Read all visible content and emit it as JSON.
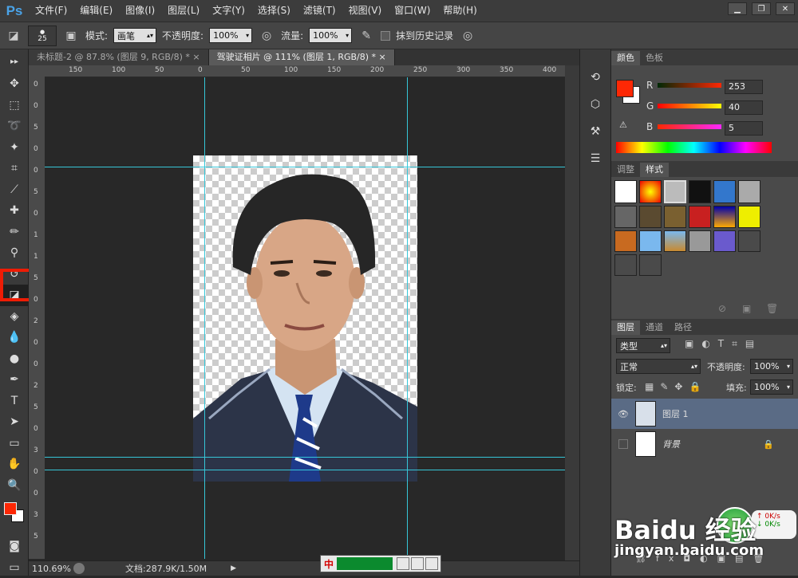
{
  "app": {
    "logo": "Ps"
  },
  "menu": [
    "文件(F)",
    "编辑(E)",
    "图像(I)",
    "图层(L)",
    "文字(Y)",
    "选择(S)",
    "滤镜(T)",
    "视图(V)",
    "窗口(W)",
    "帮助(H)"
  ],
  "options": {
    "brush_size": "25",
    "mode_label": "模式:",
    "mode_value": "画笔",
    "opacity_label": "不透明度:",
    "opacity_value": "100%",
    "flow_label": "流量:",
    "flow_value": "100%",
    "history_label": "抹到历史记录"
  },
  "tabs": [
    {
      "label": "未标题-2 @ 87.8% (图层 9, RGB/8) *",
      "close": "×"
    },
    {
      "label": "驾驶证相片 @ 111% (图层 1, RGB/8) *",
      "close": "×"
    }
  ],
  "ruler": {
    "top": [
      "150",
      "100",
      "50",
      "0",
      "50",
      "100",
      "150",
      "200",
      "250",
      "300",
      "350",
      "400"
    ],
    "left": [
      "0",
      "0",
      "5",
      "0",
      "0",
      "5",
      "0",
      "1",
      "1",
      "5",
      "0",
      "2",
      "0",
      "0",
      "2",
      "5",
      "0",
      "3",
      "0",
      "0",
      "3",
      "5"
    ]
  },
  "status": {
    "zoom": "110.69%",
    "doc": "文档:287.9K/1.50M"
  },
  "color_panel": {
    "tabs": [
      "颜色",
      "色板"
    ],
    "r_label": "R",
    "g_label": "G",
    "b_label": "B",
    "r": "253",
    "g": "40",
    "b": "5",
    "fg": "#fd2805"
  },
  "styles_panel": {
    "tabs": [
      "调整",
      "样式"
    ]
  },
  "layers_panel": {
    "tabs": [
      "图层",
      "通道",
      "路径"
    ],
    "kind": "类型",
    "blend": "正常",
    "opacity_label": "不透明度:",
    "opacity": "100%",
    "lock_label": "锁定:",
    "fill_label": "填充:",
    "fill": "100%",
    "layers": [
      {
        "name": "图层 1"
      },
      {
        "name": "背景"
      }
    ]
  },
  "network": {
    "up": "0K/s",
    "down": "0K/s"
  },
  "watermark": {
    "brand": "Baidu 经验",
    "url": "jingyan.baidu.com"
  }
}
